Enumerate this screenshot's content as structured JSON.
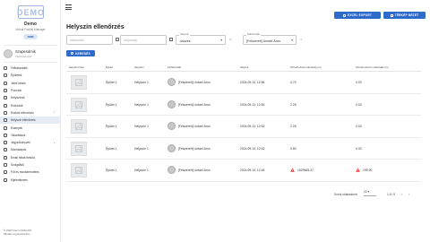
{
  "brand": {
    "logo": "DEMO",
    "title": "Demo",
    "subtitle": "Virtual Facility Manager",
    "role_badge": "FMM"
  },
  "user": {
    "name": "Szapesdmik",
    "role": "Intézményvez."
  },
  "nav": [
    {
      "label": "Felhasználók",
      "icon": "users-icon"
    },
    {
      "label": "Épületek",
      "icon": "building-icon"
    },
    {
      "label": "Jelek kezés",
      "icon": "signal-icon"
    },
    {
      "label": "Pozíciók",
      "icon": "position-icon"
    },
    {
      "label": "Helyszínek",
      "icon": "location-icon"
    },
    {
      "label": "Eszközök",
      "icon": "tools-icon"
    },
    {
      "label": "Eszköz ellenőrzés",
      "icon": "check-icon",
      "caret": "⌃"
    },
    {
      "label": "Helyszín ellenőrzés",
      "icon": "location-check-icon",
      "active": true
    },
    {
      "label": "Esemyek",
      "icon": "event-icon"
    },
    {
      "label": "Takarítások",
      "icon": "cleaning-icon"
    },
    {
      "label": "Jegyzőkönyvek",
      "icon": "document-icon",
      "caret": "⌄"
    },
    {
      "label": "Munkalapok",
      "icon": "worksheet-icon"
    },
    {
      "label": "Email hibák beküld.",
      "icon": "email-icon"
    },
    {
      "label": "Szolgáltók",
      "icon": "service-icon"
    },
    {
      "label": "Fűt és munkarendelés",
      "icon": "heating-icon"
    },
    {
      "label": "Kijelentkezés",
      "icon": "logout-icon"
    }
  ],
  "footer": {
    "line1": "© 2024 Demo Mobil Kft.",
    "line2": "Minden jog fenntartva."
  },
  "header": {
    "excel_label": "EXCEL EXPORT",
    "map_label": "TÉRKÉP NÉZET",
    "page_title": "Helyszín ellenőrzés"
  },
  "filters": {
    "date_from_placeholder": "Időponttól",
    "date_to_placeholder": "Időpontig",
    "building_label": "Helyszín",
    "building_value": "-összes-",
    "user_label": "Felhasználó",
    "user_value": "[Felszerelt] Uniwel Áron",
    "search_label": "KERESÉS"
  },
  "table": {
    "columns": [
      "Helyszíni fotó",
      "Épület",
      "Helyszín",
      "Felhasználó",
      "Időpont",
      "Ott kell elvonni távolság (m)",
      "Ott kell elvonni maximális (m)"
    ],
    "rows": [
      {
        "building": "Épület 1",
        "place": "Helyszín 1",
        "user": "[Felszerelt] Uniwel Áron",
        "time": "2024.09.13. 12:56",
        "dist": "0.70",
        "max": "0.00",
        "warn": false
      },
      {
        "building": "Épület 1",
        "place": "Helyszín 1",
        "user": "[Felszerelt] Uniwel Áron",
        "time": "2024.09.13. 12:53",
        "dist": "2.25",
        "max": "0.00",
        "warn": false
      },
      {
        "building": "Épület 1",
        "place": "Helyszín 1",
        "user": "[Felszerelt] Uniwel Áron",
        "time": "2024.09.13. 12:52",
        "dist": "2.25",
        "max": "0.00",
        "warn": false
      },
      {
        "building": "Épület 1",
        "place": "Helyszín 1",
        "user": "[Felszerelt] Uniwel Áron",
        "time": "2024.09.13. 12:52",
        "dist": "0.80",
        "max": "0.00",
        "warn": false
      },
      {
        "building": "Épület 1",
        "place": "Helyszín 1",
        "user": "[Felszerelt] Uniwel Áron",
        "time": "2024.09.13. 12:48",
        "dist": "1629565.47",
        "max": "199.90",
        "warn": true
      }
    ]
  },
  "pager": {
    "rows_label": "Sorok oldalanként:",
    "rows_value": "10",
    "range": "1-5 / 5"
  },
  "colors": {
    "primary": "#2e6ac9",
    "warn": "#e53935"
  }
}
